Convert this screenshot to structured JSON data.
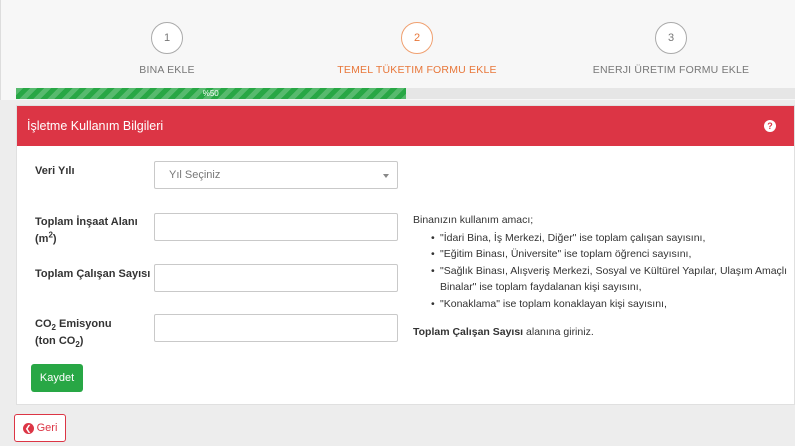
{
  "steps": [
    {
      "number": "1",
      "label": "BINA EKLE",
      "active": false
    },
    {
      "number": "2",
      "label": "TEMEL TÜKETIM FORMU EKLE",
      "active": true
    },
    {
      "number": "3",
      "label": "ENERJI ÜRETIM FORMU EKLE",
      "active": false
    }
  ],
  "progress": {
    "value": 50,
    "label": "%50"
  },
  "panel": {
    "title": "İşletme Kullanım Bilgileri",
    "help_icon": "?"
  },
  "form": {
    "year_label": "Veri Yılı",
    "year_placeholder": "Yıl Seçiniz",
    "area_label": "Toplam İnşaat Alanı",
    "area_unit_base": "(m",
    "area_unit_sup": "2",
    "area_unit_close": ")",
    "employees_label": "Toplam Çalışan Sayısı",
    "co2_label_prefix": "CO",
    "co2_label_sub": "2",
    "co2_label_suffix": " Emisyonu",
    "co2_unit_prefix": "(ton CO",
    "co2_unit_sub": "2",
    "co2_unit_close": ")",
    "save_label": "Kaydet"
  },
  "info": {
    "intro": "Binanızın kullanım amacı;",
    "items": [
      "\"İdari Bina, İş Merkezi, Diğer\" ise toplam çalışan sayısını,",
      "\"Eğitim Binası, Üniversite\" ise toplam öğrenci sayısını,",
      "\"Sağlık Binası, Alışveriş Merkezi, Sosyal ve Kültürel Yapılar, Ulaşım Amaçlı Binalar\" ise toplam faydalanan kişi sayısını,",
      "\"Konaklama\" ise toplam konaklayan kişi sayısını,"
    ],
    "footer_bold": "Toplam Çalışan Sayısı",
    "footer_rest": " alanına giriniz."
  },
  "back_label": "Geri",
  "colors": {
    "accent_red": "#dc3545",
    "success_green": "#28a745",
    "active_orange": "#e8773a"
  }
}
